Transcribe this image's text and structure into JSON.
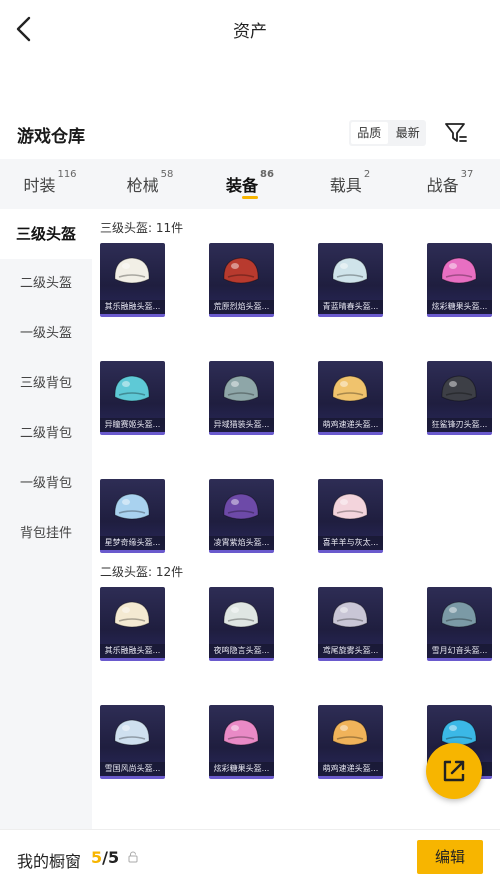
{
  "header": {
    "title": "资产"
  },
  "warehouse": {
    "title": "游戏仓库",
    "sort_options": [
      "品质",
      "最新"
    ]
  },
  "tabs": [
    {
      "label": "时装",
      "count": "116"
    },
    {
      "label": "枪械",
      "count": "58"
    },
    {
      "label": "装备",
      "count": "86"
    },
    {
      "label": "载具",
      "count": "2"
    },
    {
      "label": "战备",
      "count": "37"
    }
  ],
  "sidebar": {
    "items": [
      "三级头盔",
      "二级头盔",
      "一级头盔",
      "三级背包",
      "二级背包",
      "一级背包",
      "背包挂件"
    ]
  },
  "sections": [
    {
      "title": "三级头盔: 11件",
      "items": [
        {
          "name": "其乐融融头盔...",
          "color": "#f2efe6"
        },
        {
          "name": "荒原烈焰头盔...",
          "color": "#b83a2e"
        },
        {
          "name": "青蓝晴春头盔...",
          "color": "#cfe3ea"
        },
        {
          "name": "炫彩糖果头盔...",
          "color": "#e86fc2"
        },
        {
          "name": "异瞳赛姬头盔...",
          "color": "#5ec9d6"
        },
        {
          "name": "异域猎装头盔...",
          "color": "#8ea6a8"
        },
        {
          "name": "萌鸡速递头盔...",
          "color": "#f0c36d"
        },
        {
          "name": "狂鲨锋刃头盔...",
          "color": "#3d3f46"
        },
        {
          "name": "星梦奇缘头盔...",
          "color": "#a9d2ef"
        },
        {
          "name": "凌霄紫焰头盔...",
          "color": "#6d4aa8"
        },
        {
          "name": "喜羊羊与灰太...",
          "color": "#f3d4dc"
        }
      ]
    },
    {
      "title": "二级头盔: 12件",
      "items": [
        {
          "name": "其乐融融头盔...",
          "color": "#f4ead2"
        },
        {
          "name": "夜鸣隐言头盔...",
          "color": "#dfe6e3"
        },
        {
          "name": "鸢尾旋雾头盔...",
          "color": "#c9c6d6"
        },
        {
          "name": "雪月幻音头盔...",
          "color": "#7b9aa6"
        },
        {
          "name": "雪国风尚头盔...",
          "color": "#cfe0ef"
        },
        {
          "name": "炫彩糖果头盔...",
          "color": "#e98ac6"
        },
        {
          "name": "萌鸡速递头盔...",
          "color": "#f0b35a"
        },
        {
          "name": "",
          "color": "#3bb8e6"
        }
      ]
    }
  ],
  "showcase": {
    "label": "我的橱窗",
    "current": "5",
    "total": "/5"
  },
  "edit_label": "编辑"
}
